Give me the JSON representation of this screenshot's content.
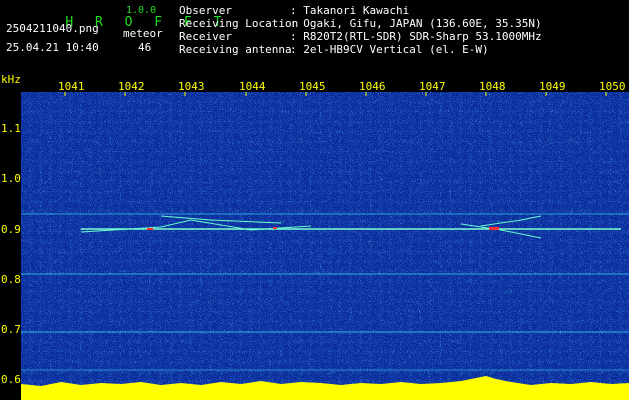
{
  "app": {
    "name": "H R O F F T",
    "version": "1.0.0"
  },
  "file": {
    "name": "2504211040.png",
    "datetime": "25.04.21 10:40"
  },
  "detection": {
    "label": "meteor",
    "count": "46"
  },
  "info": [
    {
      "key": "Observer",
      "value": ": Takanori Kawachi"
    },
    {
      "key": "Receiving Location",
      "value": ": Ogaki, Gifu, JAPAN (136.60E, 35.35N)"
    },
    {
      "key": "Receiver",
      "value": ": R820T2(RTL-SDR) SDR-Sharp 53.1000MHz"
    },
    {
      "key": "Receiving antenna",
      "value": ": 2el-HB9CV Vertical (el. E-W)"
    }
  ],
  "axis": {
    "y_unit": "kHz",
    "y_ticks": [
      "1.1",
      "1.0",
      "0.9",
      "0.8",
      "0.7",
      "0.6"
    ],
    "x_ticks": [
      "1041",
      "1042",
      "1043",
      "1044",
      "1045",
      "1046",
      "1047",
      "1048",
      "1049",
      "1050"
    ]
  },
  "colors": {
    "background": "#000000",
    "label": "#ffff00",
    "header_green": "#22dd22",
    "waterfall": "#0a2a9a"
  }
}
